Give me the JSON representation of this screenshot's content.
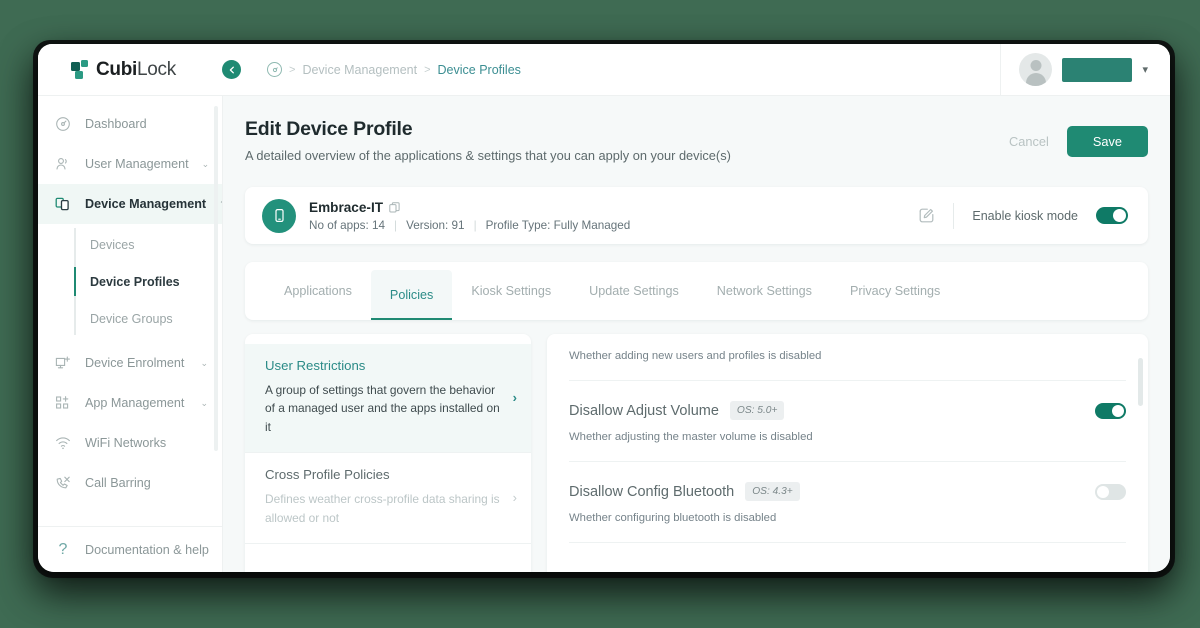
{
  "brand": {
    "name_bold": "Cubi",
    "name_light": "Lock",
    "accent": "#1f8a73",
    "accent_dark": "#0f5e52",
    "accent_light": "#2b9a83",
    "page_background": "#3f6b53"
  },
  "topbar": {
    "collapse_label": "Collapse sidebar",
    "breadcrumb": {
      "home": "home",
      "separator": ">",
      "items": [
        {
          "label": "Device Management",
          "active": false
        },
        {
          "label": "Device Profiles",
          "active": true
        }
      ]
    },
    "user": {
      "name_redacted": "",
      "chevron": "▾"
    }
  },
  "sidebar": {
    "items": [
      {
        "label": "Dashboard",
        "icon": "dashboard-icon",
        "expandable": false,
        "active": false
      },
      {
        "label": "User Management",
        "icon": "users-icon",
        "expandable": true,
        "active": false,
        "chevron": "⌄"
      },
      {
        "label": "Device Management",
        "icon": "devices-icon",
        "expandable": true,
        "active": true,
        "chevron": "⌃"
      },
      {
        "label": "Device Enrolment",
        "icon": "monitor-plus-icon",
        "expandable": true,
        "active": false,
        "chevron": "⌄"
      },
      {
        "label": "App Management",
        "icon": "grid-plus-icon",
        "expandable": true,
        "active": false,
        "chevron": "⌄"
      },
      {
        "label": "WiFi Networks",
        "icon": "wifi-icon",
        "expandable": false,
        "active": false
      },
      {
        "label": "Call Barring",
        "icon": "call-barring-icon",
        "expandable": false,
        "active": false
      }
    ],
    "subitems": [
      {
        "label": "Devices",
        "active": false
      },
      {
        "label": "Device Profiles",
        "active": true
      },
      {
        "label": "Device Groups",
        "active": false
      }
    ],
    "footer": {
      "label": "Documentation & help",
      "icon": "question-icon",
      "glyph": "?"
    }
  },
  "page": {
    "title": "Edit Device Profile",
    "subtitle": "A detailed overview of the applications & settings that you can apply on your device(s)",
    "cancel_label": "Cancel",
    "save_label": "Save"
  },
  "profile_card": {
    "device_icon": "phone-icon",
    "name": "Embrace-IT",
    "copy_icon": "copy-icon",
    "meta": [
      "No of apps: 14",
      "Version: 91",
      "Profile Type: Fully Managed"
    ],
    "meta_divider": "|",
    "edit_icon": "edit-pencil-icon",
    "kiosk_label": "Enable kiosk mode",
    "kiosk_enabled": true
  },
  "tabs": [
    {
      "label": "Applications",
      "active": false
    },
    {
      "label": "Policies",
      "active": true
    },
    {
      "label": "Kiosk Settings",
      "active": false
    },
    {
      "label": "Update Settings",
      "active": false
    },
    {
      "label": "Network Settings",
      "active": false
    },
    {
      "label": "Privacy Settings",
      "active": false
    }
  ],
  "policy_groups": [
    {
      "title": "User Restrictions",
      "description": "A group of settings that govern the behavior of a managed user and the apps installed on it",
      "arrow": "›",
      "active": true
    },
    {
      "title": "Cross Profile Policies",
      "description": "Defines weather cross-profile data sharing is allowed or not",
      "arrow": "›",
      "active": false
    }
  ],
  "policy_rows": [
    {
      "partial": true,
      "title": "",
      "os_badge": "",
      "description": "Whether adding new users and profiles is disabled",
      "enabled": null
    },
    {
      "partial": false,
      "title": "Disallow Adjust Volume",
      "os_badge": "OS: 5.0+",
      "description": "Whether adjusting the master volume is disabled",
      "enabled": true
    },
    {
      "partial": false,
      "title": "Disallow Config Bluetooth",
      "os_badge": "OS: 4.3+",
      "description": "Whether configuring bluetooth is disabled",
      "enabled": false
    }
  ]
}
